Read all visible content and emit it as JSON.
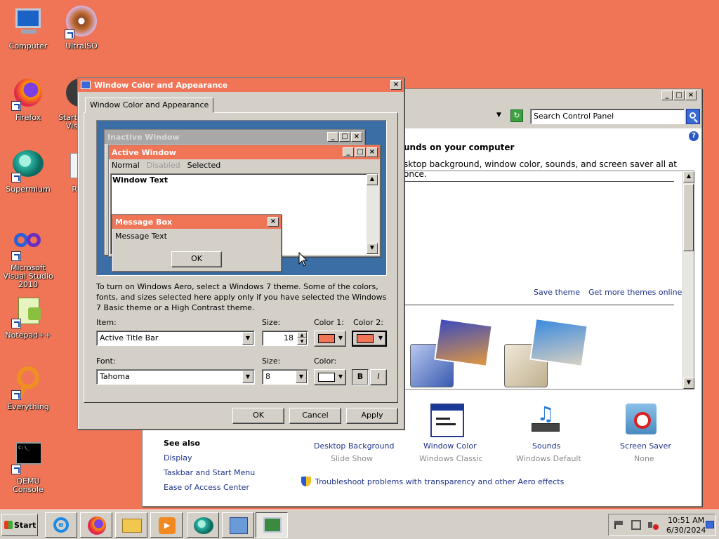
{
  "desktop": {
    "icons": [
      {
        "label": "Computer"
      },
      {
        "label": "UltraISO"
      },
      {
        "label": "Firefox"
      },
      {
        "label": "Start\nVis"
      },
      {
        "label": "Supermium"
      },
      {
        "label": "R"
      },
      {
        "label": "Microsoft Visual Studio 2010"
      },
      {
        "label": "Notepad++"
      },
      {
        "label": "Everything"
      },
      {
        "label": "QEMU Console"
      }
    ]
  },
  "control_panel": {
    "search_placeholder": "Search Control Panel",
    "heading": "unds on your computer",
    "subheading": "sktop background, window color, sounds, and screen saver all at once.",
    "save_theme": "Save theme",
    "get_more": "Get more themes online",
    "see_also": "See also",
    "links": [
      "Display",
      "Taskbar and Start Menu",
      "Ease of Access Center"
    ],
    "items": [
      {
        "label": "Desktop Background",
        "sub": "Slide Show"
      },
      {
        "label": "Window Color",
        "sub": "Windows Classic"
      },
      {
        "label": "Sounds",
        "sub": "Windows Default"
      },
      {
        "label": "Screen Saver",
        "sub": "None"
      }
    ],
    "troubleshoot": "Troubleshoot problems with transparency and other Aero effects"
  },
  "dialog": {
    "title": "Window Color and Appearance",
    "tab": "Window Color and Appearance",
    "preview": {
      "inactive_title": "Inactive Window",
      "active_title": "Active Window",
      "menu_normal": "Normal",
      "menu_disabled": "Disabled",
      "menu_selected": "Selected",
      "window_text": "Window Text",
      "msg_title": "Message Box",
      "msg_text": "Message Text",
      "msg_ok": "OK"
    },
    "info": "To turn on Windows Aero, select a Windows 7 theme.  Some of the colors, fonts, and sizes selected here apply only if you have selected the Windows 7 Basic theme or a High Contrast theme.",
    "item_label": "Item:",
    "item_value": "Active Title Bar",
    "size_label": "Size:",
    "size_value": "18",
    "color1_label": "Color 1:",
    "color2_label": "Color 2:",
    "font_label": "Font:",
    "font_value": "Tahoma",
    "fsize_label": "Size:",
    "fsize_value": "8",
    "fcolor_label": "Color:",
    "bold": "B",
    "italic": "I",
    "ok": "OK",
    "cancel": "Cancel",
    "apply": "Apply",
    "accent": "#F07556"
  },
  "taskbar": {
    "start": "Start",
    "time": "10:51 AM",
    "date": "6/30/2024"
  }
}
